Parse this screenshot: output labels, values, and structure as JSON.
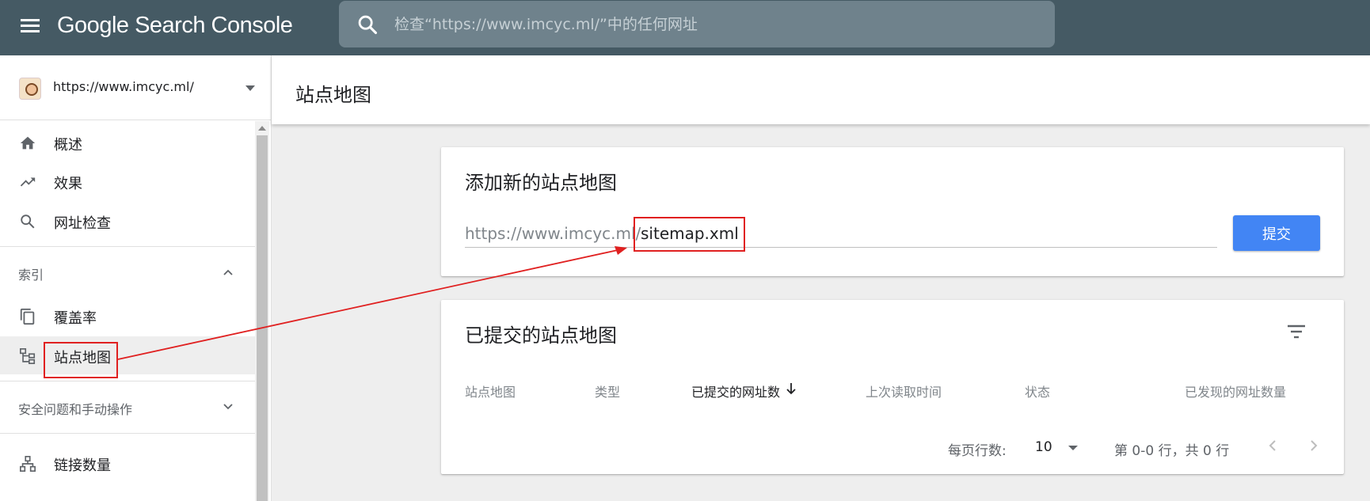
{
  "header": {
    "app_name": "Google Search Console",
    "search_placeholder": "检查“https://www.imcyc.ml/”中的任何网址"
  },
  "sidebar": {
    "property_url": "https://www.imcyc.ml/",
    "items_top": [
      {
        "label": "概述",
        "icon": "home-icon"
      },
      {
        "label": "效果",
        "icon": "trending-up-icon"
      },
      {
        "label": "网址检查",
        "icon": "search-icon"
      }
    ],
    "section_index": "索引",
    "items_index": [
      {
        "label": "覆盖率",
        "icon": "copy-icon"
      },
      {
        "label": "站点地图",
        "icon": "sitemap-icon",
        "active": true
      }
    ],
    "section_security": "安全问题和手动操作",
    "items_bottom": [
      {
        "label": "链接数量",
        "icon": "links-icon"
      }
    ]
  },
  "main": {
    "page_title": "站点地图",
    "add_card": {
      "title": "添加新的站点地图",
      "prefix": "https://www.imcyc.ml/",
      "input_value": "sitemap.xml",
      "submit_label": "提交"
    },
    "submitted_card": {
      "title": "已提交的站点地图",
      "columns": [
        "站点地图",
        "类型",
        "已提交的网址数",
        "上次读取时间",
        "状态",
        "已发现的网址数量"
      ],
      "rows_per_page_label": "每页行数:",
      "rows_per_page_value": "10",
      "range_text": "第 0-0 行，共 0 行"
    }
  },
  "colors": {
    "header_bg": "#455a64",
    "accent": "#4285f4",
    "annotation": "#e02020"
  }
}
